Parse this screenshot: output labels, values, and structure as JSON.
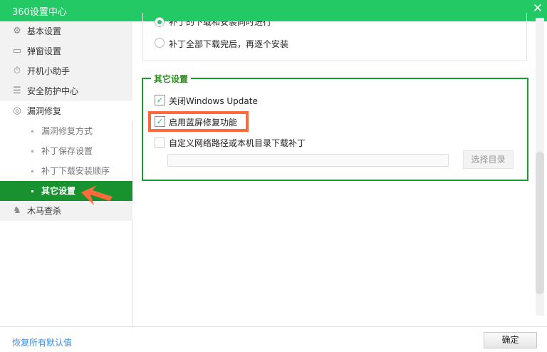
{
  "window": {
    "title": "360设置中心",
    "close_icon": "close-icon"
  },
  "sidebar": {
    "items": [
      {
        "label": "基本设置",
        "icon": "gear-icon"
      },
      {
        "label": "弹窗设置",
        "icon": "window-icon"
      },
      {
        "label": "开机小助手",
        "icon": "stopwatch-icon"
      },
      {
        "label": "安全防护中心",
        "icon": "shield-grid-icon"
      },
      {
        "label": "漏洞修复",
        "icon": "patch-icon"
      },
      {
        "label": "木马查杀",
        "icon": "horse-icon"
      }
    ],
    "subitems": [
      {
        "label": "漏洞修复方式"
      },
      {
        "label": "补丁保存设置"
      },
      {
        "label": "补丁下载安装顺序"
      },
      {
        "label": "其它设置",
        "selected": true
      }
    ]
  },
  "install_order": {
    "options": [
      {
        "label": "补丁的下载和安装同时进行",
        "selected": true
      },
      {
        "label": "补丁全部下载完后，再逐个安装",
        "selected": false
      }
    ]
  },
  "other_settings": {
    "title": "其它设置",
    "options": [
      {
        "label": "关闭Windows Update",
        "checked": true
      },
      {
        "label": "启用蓝屏修复功能",
        "checked": true,
        "highlighted": true
      },
      {
        "label": "自定义网络路径或本机目录下载补丁",
        "checked": false
      }
    ],
    "path_value": "",
    "pick_dir_label": "选择目录"
  },
  "footer": {
    "reset_label": "恢复所有默认值",
    "ok_label": "确定"
  },
  "colors": {
    "title_bar": "#22c964",
    "selected": "#17922f",
    "highlight": "#ff6a3d",
    "group_border": "#1a9a33"
  }
}
